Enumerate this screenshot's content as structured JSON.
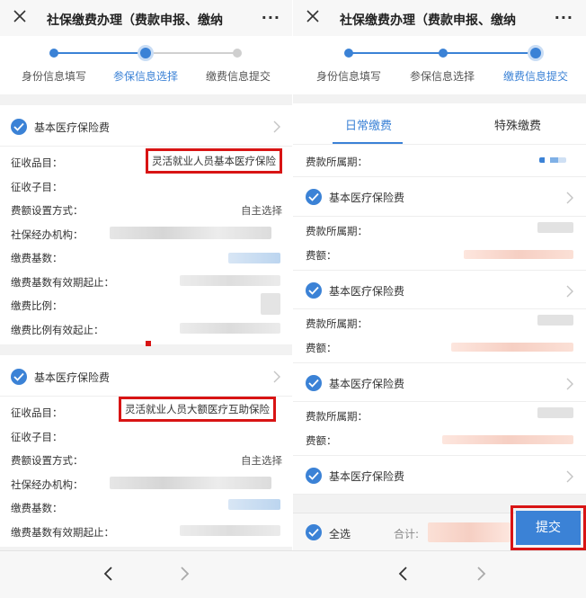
{
  "colors": {
    "accent": "#3b82d6",
    "highlight_border": "#d81414",
    "blur_gray": "#dcdcdc",
    "blur_blue": "#bcd5ef",
    "blur_peach": "#f6cfc3"
  },
  "left": {
    "title": "社保缴费办理（费款申报、缴纳",
    "steps": [
      "身份信息填写",
      "参保信息选择",
      "缴费信息提交"
    ],
    "active_step": 1,
    "cards": [
      {
        "title": "基本医疗保险费",
        "rows": [
          {
            "label": "征收品目：",
            "value": "灵活就业人员基本医疗保险"
          },
          {
            "label": "征收子目：",
            "value": ""
          },
          {
            "label": "费额设置方式：",
            "value": "自主选择"
          },
          {
            "label": "社保经办机构：",
            "value": ""
          },
          {
            "label": "缴费基数：",
            "value": ""
          },
          {
            "label": "缴费基数有效期起止：",
            "value": ""
          },
          {
            "label": "缴费比例：",
            "value": ""
          },
          {
            "label": "缴费比例有效起止：",
            "value": ""
          }
        ]
      },
      {
        "title": "基本医疗保险费",
        "rows": [
          {
            "label": "征收品目：",
            "value": "灵活就业人员大额医疗互助保险"
          },
          {
            "label": "征收子目：",
            "value": ""
          },
          {
            "label": "费额设置方式：",
            "value": "自主选择"
          },
          {
            "label": "社保经办机构：",
            "value": ""
          },
          {
            "label": "缴费基数：",
            "value": ""
          },
          {
            "label": "缴费基数有效期起止：",
            "value": ""
          }
        ]
      }
    ]
  },
  "right": {
    "title": "社保缴费办理（费款申报、缴纳",
    "steps": [
      "身份信息填写",
      "参保信息选择",
      "缴费信息提交"
    ],
    "active_step": 2,
    "tabs": [
      "日常缴费",
      "特殊缴费"
    ],
    "active_tab": 0,
    "period_label": "费款所属期：",
    "items": [
      {
        "title": "基本医疗保险费",
        "period_label": "费款所属期：",
        "amount_label": "费额："
      },
      {
        "title": "基本医疗保险费",
        "period_label": "费款所属期：",
        "amount_label": "费额："
      },
      {
        "title": "基本医疗保险费",
        "period_label": "费款所属期：",
        "amount_label": "费额："
      },
      {
        "title": "基本医疗保险费"
      }
    ],
    "footer": {
      "select_all": "全选",
      "total_label": "合计:",
      "submit": "提交"
    }
  },
  "icons": {
    "close": "close-icon",
    "more": "more-icon",
    "more_glyph": "···",
    "check": "check-circle-icon",
    "chevron": "chevron-right-icon",
    "back": "back-arrow-icon",
    "forward": "forward-arrow-icon"
  }
}
